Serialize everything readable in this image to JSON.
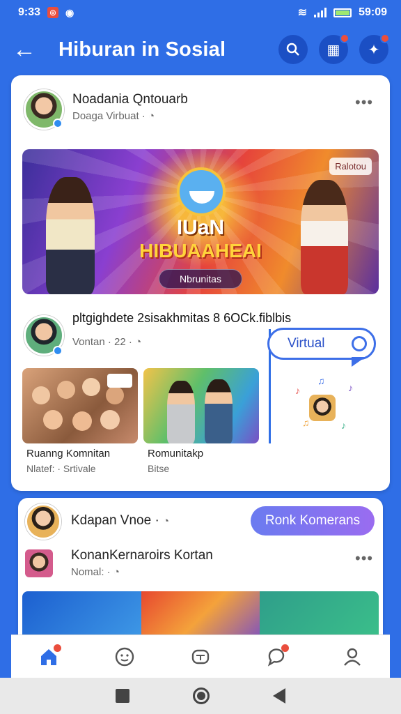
{
  "status_bar": {
    "time": "9:33",
    "right_time": "59:09"
  },
  "header": {
    "title": "Hiburan in Sosial"
  },
  "post1": {
    "author": "Noadania Qntouarb",
    "sub": "Doaga Virbuat ·",
    "banner": {
      "tag": "Ralotou",
      "line1": "IUaN",
      "line2": "HIBUAAHEAI",
      "pill": "Nbrunitas"
    }
  },
  "post2": {
    "text": "pltgighdete  2sisakhmitas  8 6OCk.fiblbis",
    "sub": "Vontan · 22 ·",
    "thumbs": [
      {
        "caption": "Ruanng Komnitan",
        "sub": "Nlatef: · Srtivale"
      },
      {
        "caption": "Romunitakp",
        "sub": "Bitse"
      }
    ],
    "virtual_label": "Virtual"
  },
  "post3": {
    "author": "Kdapan Vnoe ·",
    "cta": "Ronk Komerans",
    "item_title": "KonanKernaroirs Kortan",
    "item_sub": "Nomal: ·"
  },
  "nav": {
    "items": [
      "home-icon",
      "chat-face-icon",
      "video-icon",
      "message-icon",
      "profile-icon"
    ]
  },
  "colors": {
    "primary": "#2f6ee6",
    "badge": "#ea4e3d"
  }
}
